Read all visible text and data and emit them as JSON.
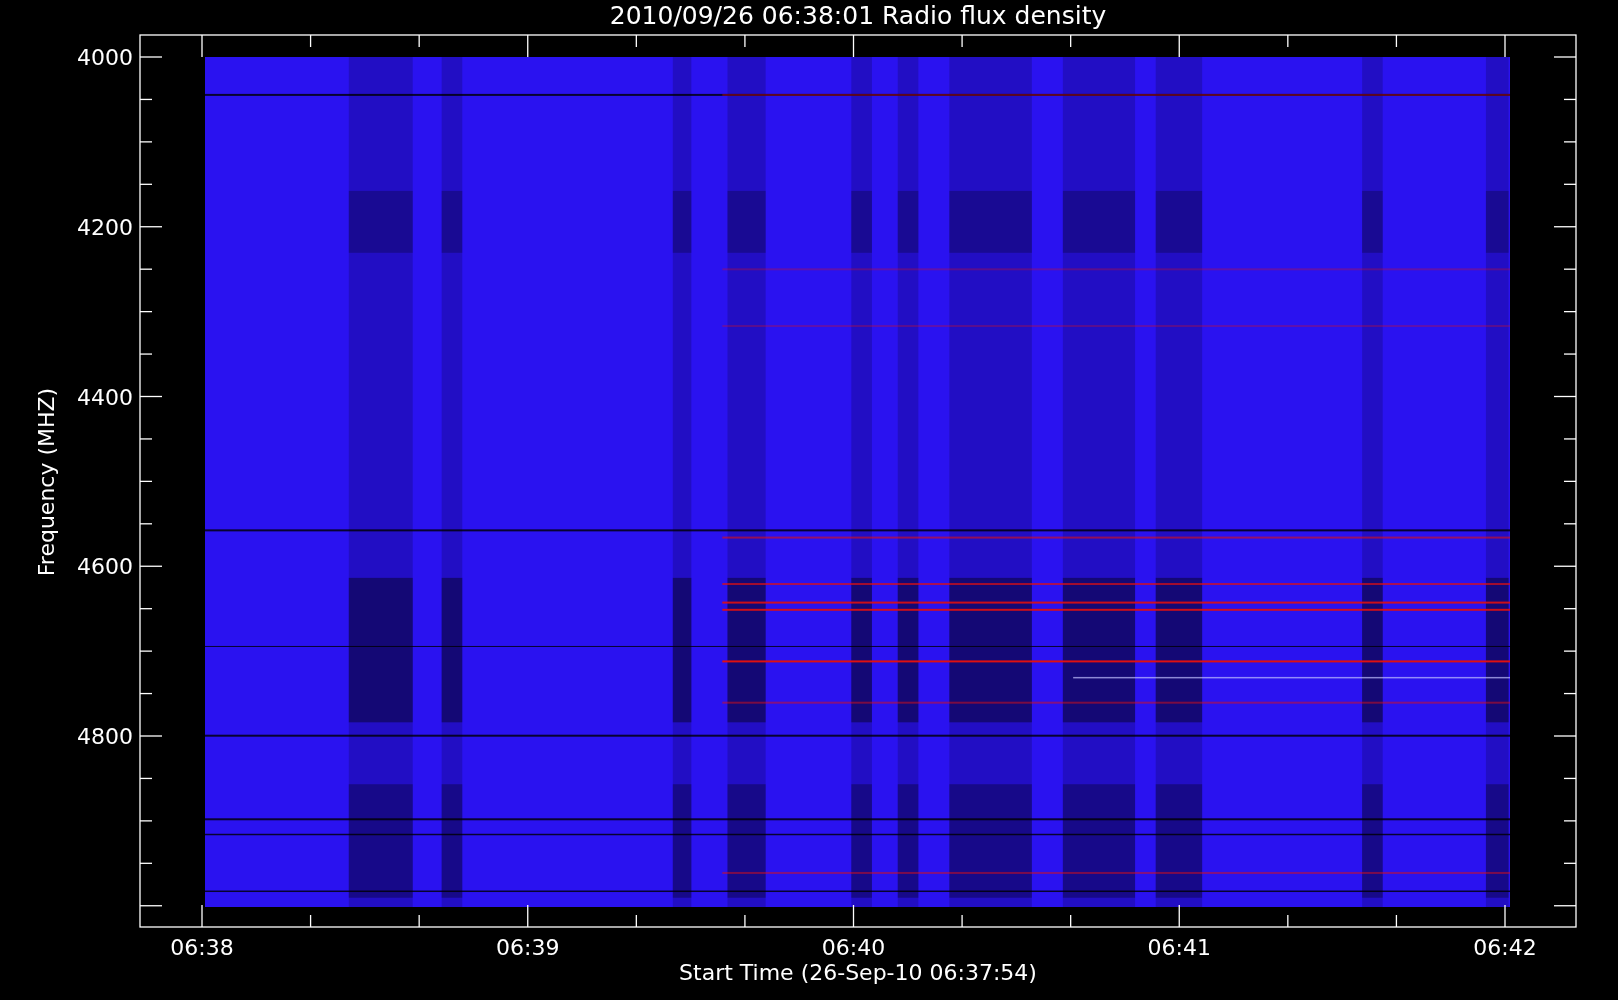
{
  "title": "2010/09/26 06:38:01 Radio flux density",
  "y_axis": {
    "label": "Frequency (MHZ)",
    "ticks": [
      "4000",
      "4200",
      "4400",
      "4600",
      "4800"
    ]
  },
  "x_axis": {
    "label": "Start Time (26-Sep-10 06:37:54)",
    "ticks": [
      "06:38",
      "06:39",
      "06:40",
      "06:41",
      "06:42"
    ]
  }
}
